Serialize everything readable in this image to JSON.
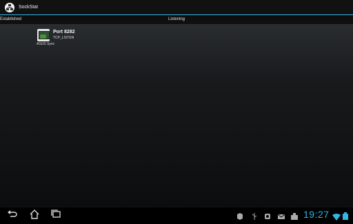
{
  "app": {
    "title": "SockStat"
  },
  "tabs": [
    {
      "label": "Established"
    },
    {
      "label": "Listening"
    }
  ],
  "listening": [
    {
      "port": "Port 8282",
      "state": "TCP_LISTEN",
      "app": "ASUS Sync"
    }
  ],
  "system_bar": {
    "clock": "19:27",
    "nav_icons": [
      "back-icon",
      "home-icon",
      "recent-apps-icon"
    ],
    "status_icons": [
      "notification-app-icon",
      "usb-icon",
      "sync-icon",
      "mail-icon",
      "download-icon",
      "wifi-icon",
      "battery-icon"
    ]
  },
  "colors": {
    "accent": "#33b5e5",
    "action_bar": "#111111",
    "background": "#000000"
  }
}
